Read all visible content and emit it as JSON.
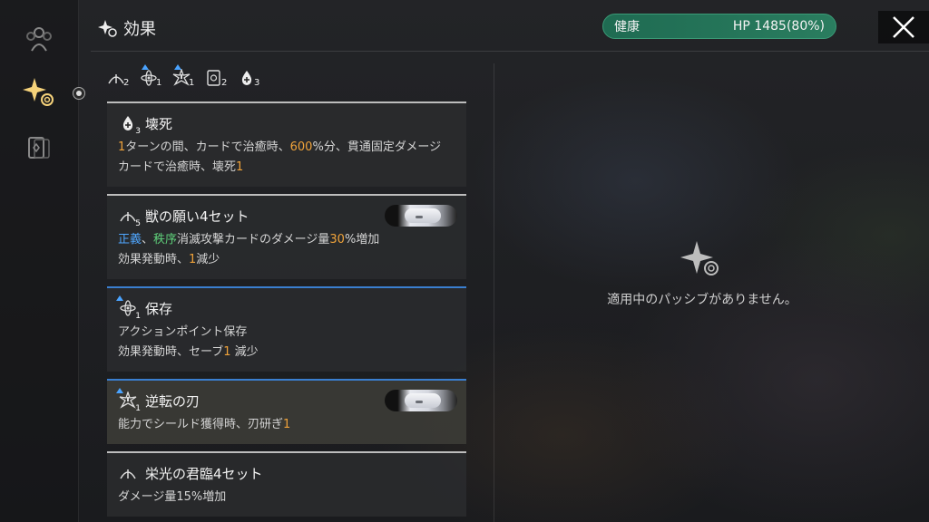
{
  "header": {
    "title": "効果",
    "hp_status": "健康",
    "hp_value": "HP 1485(80%)"
  },
  "stack_row": [
    {
      "icon": "leaf-icon",
      "count": "2"
    },
    {
      "icon": "atom-icon",
      "count": "1",
      "upgraded": true
    },
    {
      "icon": "burst-icon",
      "count": "1",
      "upgraded": true
    },
    {
      "icon": "card-icon",
      "count": "2"
    },
    {
      "icon": "drop-icon",
      "count": "3"
    }
  ],
  "cards": [
    {
      "title": "壊死",
      "icon_count": "3",
      "line1": {
        "a": "1",
        "b": "ターンの間、カードで治癒時、",
        "c": "600",
        "d": "%分、貫通固定ダメージ"
      },
      "line2": {
        "a": "カードで治癒時、壊死",
        "b": "1"
      }
    },
    {
      "title": "獣の願い4セット",
      "icon_count": "5",
      "line1": {
        "a": "正義",
        "sep": "、",
        "b": "秩序",
        "c": "消滅攻撃カードのダメージ量",
        "d": "30",
        "e": "%増加"
      },
      "line2": {
        "a": "効果発動時、",
        "b": "1",
        "c": "減少"
      }
    },
    {
      "title": "保存",
      "icon_count": "1",
      "line1": "アクションポイント保存",
      "line2": {
        "a": "効果発動時、セーブ",
        "b": "1",
        "c": " 減少"
      }
    },
    {
      "title": "逆転の刃",
      "icon_count": "1",
      "line1": {
        "a": "能力でシールド獲得時、刃研ぎ",
        "b": "1"
      }
    },
    {
      "title": "栄光の君臨4セット",
      "line1": "ダメージ量15%増加"
    }
  ],
  "empty_panel": {
    "message": "適用中のパッシブがありません。"
  },
  "colors": {
    "accent_orange": "#f0a33a",
    "blue": "#4fa7ff",
    "green": "#5fd07a",
    "hp_green": "#2a7d5f"
  }
}
